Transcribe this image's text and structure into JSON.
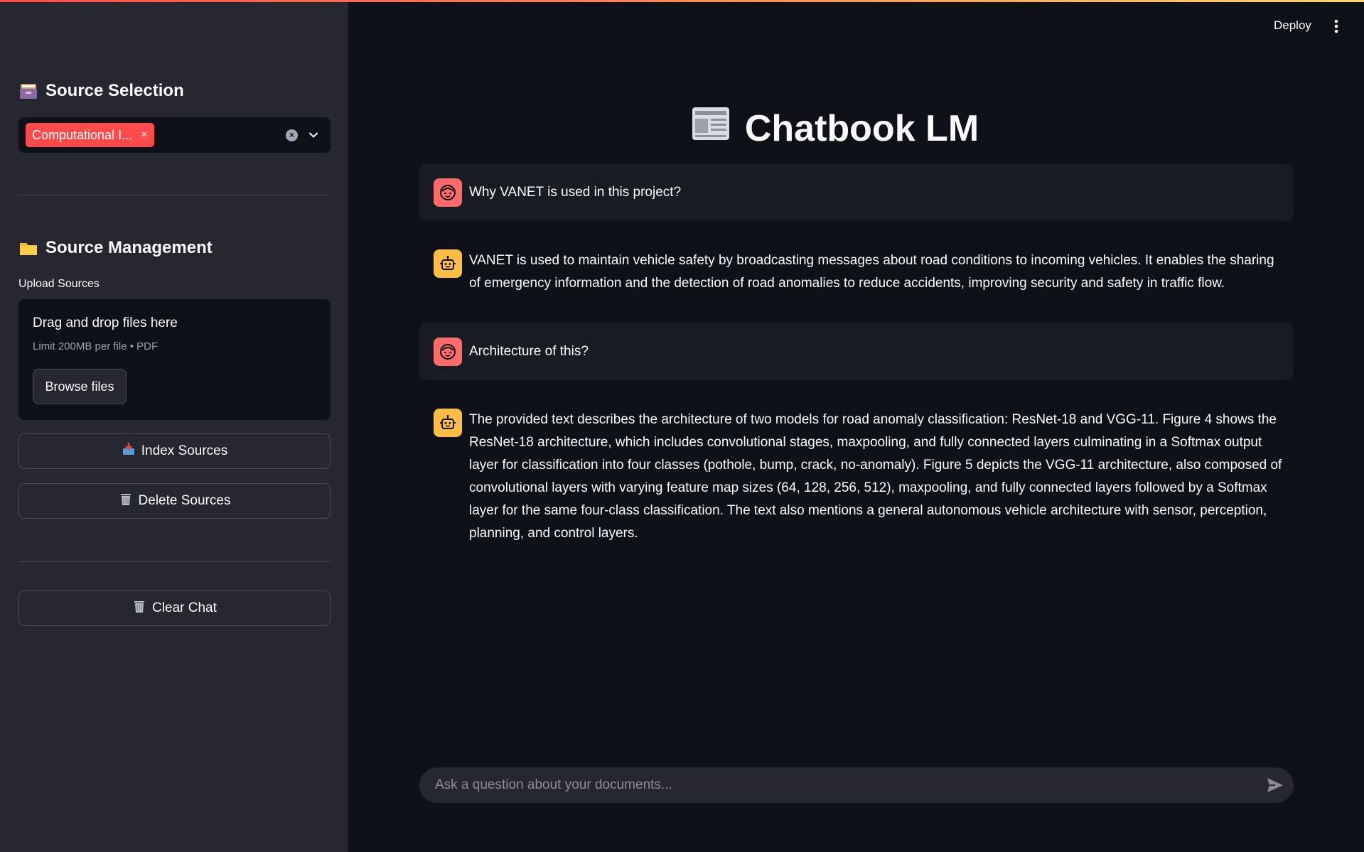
{
  "header": {
    "deploy_label": "Deploy",
    "menu_icon": "kebab-menu-icon"
  },
  "sidebar": {
    "source_selection": {
      "heading": "Source Selection",
      "heading_icon": "card-file-box-icon",
      "selected_chip": "Computational I...",
      "chip_remove": "×"
    },
    "source_management": {
      "heading": "Source Management",
      "heading_icon": "folder-icon",
      "upload_label": "Upload Sources",
      "dropzone_title": "Drag and drop files here",
      "dropzone_hint": "Limit 200MB per file • PDF",
      "browse_label": "Browse files"
    },
    "buttons": {
      "index_label": "Index Sources",
      "index_icon": "inbox-tray-icon",
      "delete_label": "Delete Sources",
      "delete_icon": "wastebasket-icon",
      "clear_label": "Clear Chat",
      "clear_icon": "wastebasket-icon"
    }
  },
  "main": {
    "title": "Chatbook LM",
    "title_icon": "newspaper-icon",
    "messages": [
      {
        "role": "user",
        "text": "Why VANET is used in this project?"
      },
      {
        "role": "assistant",
        "text": "VANET is used to maintain vehicle safety by broadcasting messages about road conditions to incoming vehicles. It enables the sharing of emergency information and the detection of road anomalies to reduce accidents, improving security and safety in traffic flow."
      },
      {
        "role": "user",
        "text": "Architecture of this?"
      },
      {
        "role": "assistant",
        "text": "The provided text describes the architecture of two models for road anomaly classification: ResNet-18 and VGG-11. Figure 4 shows the ResNet-18 architecture, which includes convolutional stages, maxpooling, and fully connected layers culminating in a Softmax output layer for classification into four classes (pothole, bump, crack, no-anomaly). Figure 5 depicts the VGG-11 architecture, also composed of convolutional layers with varying feature map sizes (64, 128, 256, 512), maxpooling, and fully connected layers followed by a Softmax layer for the same four-class classification. The text also mentions a general autonomous vehicle architecture with sensor, perception, planning, and control layers."
      }
    ],
    "chat_input": {
      "placeholder": "Ask a question about your documents...",
      "value": ""
    }
  },
  "colors": {
    "accent": "#ff4b4b",
    "user_avatar": "#ff6b6b",
    "bot_avatar": "#ffbd45",
    "background": "#0e1117",
    "sidebar": "#262730"
  }
}
